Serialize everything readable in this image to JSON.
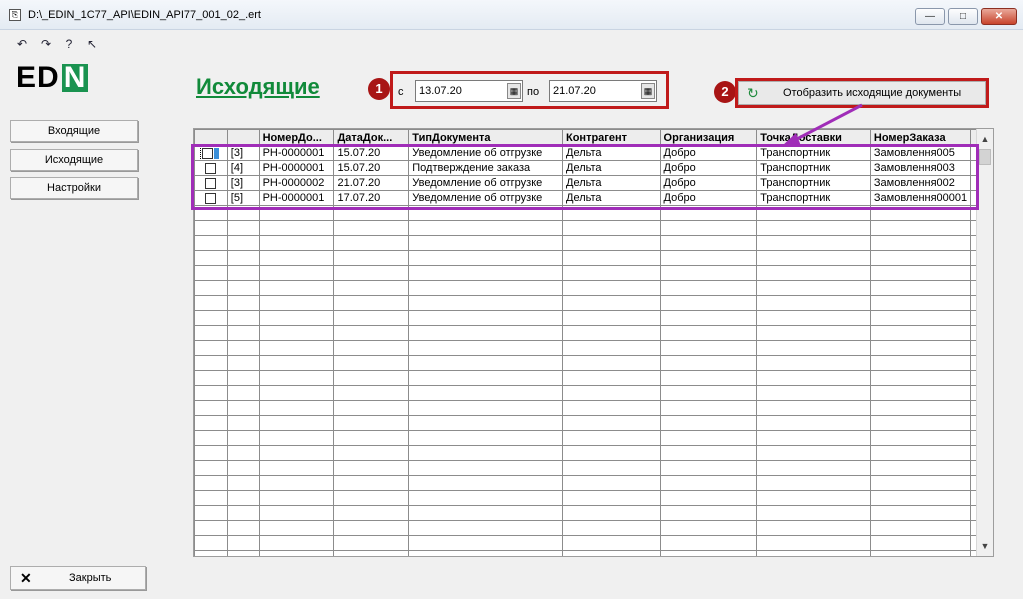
{
  "window": {
    "title": "D:\\_EDIN_1C77_API\\EDIN_API77_001_02_.ert",
    "app_icon": "document-icon",
    "buttons": {
      "minimize": "—",
      "maximize": "□",
      "close": "✕"
    }
  },
  "toolbar": {
    "icons": [
      "undo-icon",
      "redo-icon",
      "help-icon",
      "cursor-help-icon"
    ]
  },
  "logo": {
    "text_prefix": "ED",
    "text_suffix": "N",
    "brand_color": "#1a9350"
  },
  "page": {
    "title": "Исходящие",
    "title_color": "#118a3a"
  },
  "annotations": {
    "marker1": "1",
    "marker2": "2",
    "marker_color": "#a81515",
    "frame_color": "#c01a1a",
    "highlight_color": "#a02db8"
  },
  "filter": {
    "from_label": "с",
    "from_value": "13.07.20",
    "to_label": "по",
    "to_value": "21.07.20",
    "calendar_icon": "calendar-icon"
  },
  "show_button": {
    "label": "Отобразить исходящие документы",
    "icon": "refresh-icon"
  },
  "sidebar": {
    "items": [
      {
        "label": "Входящие"
      },
      {
        "label": "Исходящие"
      },
      {
        "label": "Настройки"
      }
    ]
  },
  "table": {
    "columns": [
      "",
      "",
      "НомерДо...",
      "ДатаДок...",
      "ТипДокумента",
      "Контрагент",
      "Организация",
      "ТочкаДоставки",
      "НомерЗаказа"
    ],
    "rows": [
      {
        "num": "[3]",
        "doc_number": "РН-0000001",
        "doc_date": "15.07.20",
        "doc_type": "Уведомление об отгрузке",
        "counterparty": "Дельта",
        "organization": "Добро",
        "delivery_point": "Транспортник",
        "order_number": "Замовлення005"
      },
      {
        "num": "[4]",
        "doc_number": "РН-0000001",
        "doc_date": "15.07.20",
        "doc_type": "Подтверждение заказа",
        "counterparty": "Дельта",
        "organization": "Добро",
        "delivery_point": "Транспортник",
        "order_number": "Замовлення003"
      },
      {
        "num": "[3]",
        "doc_number": "РН-0000002",
        "doc_date": "21.07.20",
        "doc_type": "Уведомление об отгрузке",
        "counterparty": "Дельта",
        "organization": "Добро",
        "delivery_point": "Транспортник",
        "order_number": "Замовлення002"
      },
      {
        "num": "[5]",
        "doc_number": "РН-0000001",
        "doc_date": "17.07.20",
        "doc_type": "Уведомление об отгрузке",
        "counterparty": "Дельта",
        "organization": "Добро",
        "delivery_point": "Транспортник",
        "order_number": "Замовлення00001"
      }
    ]
  },
  "scrollbar": {
    "up": "▲",
    "down": "▼"
  },
  "footer": {
    "close_label": "Закрыть",
    "close_icon": "✕"
  }
}
